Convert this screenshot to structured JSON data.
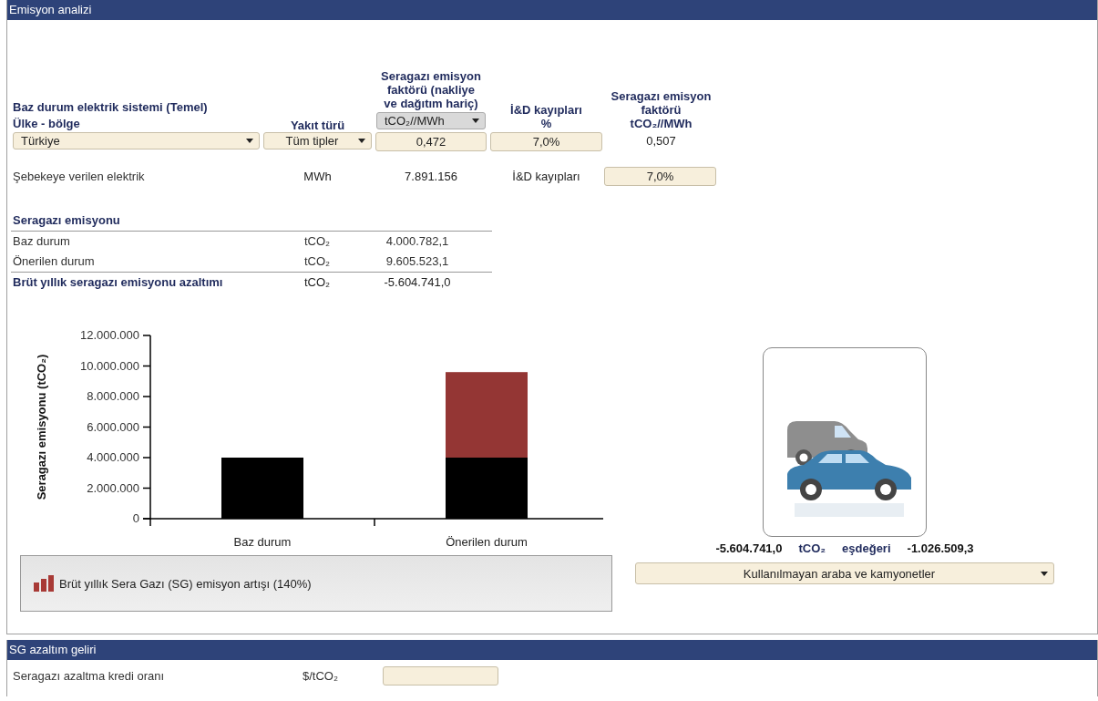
{
  "panel": {
    "title": "Emisyon analizi"
  },
  "baseline": {
    "heading": "Baz durum elektrik sistemi (Temel)",
    "columns": [
      {
        "label": "Ülke - bölge"
      },
      {
        "label": "Yakıt türü"
      },
      {
        "label": "Seragazı emisyon faktörü (nakliye ve dağıtım hariç)",
        "unit_selector": "tCO₂//MWh"
      },
      {
        "label": "İ&D kayıpları",
        "unit": "%"
      },
      {
        "label": "Seragazı emisyon faktörü",
        "unit": "tCO₂//MWh"
      }
    ],
    "row": [
      {
        "kind": "dropdown",
        "value": "Türkiye"
      },
      {
        "kind": "dropdown",
        "value": "Tüm tipler"
      },
      {
        "kind": "input",
        "value": "0,472"
      },
      {
        "kind": "input",
        "value": "7,0%"
      },
      {
        "kind": "text",
        "value": "0,507"
      }
    ]
  },
  "electricity": {
    "label": "Şebekeye verilen elektrik",
    "unit": "MWh",
    "value": "7.891.156",
    "losses_label": "İ&D kayıpları",
    "losses_value": "7,0%"
  },
  "emissions": {
    "heading": "Seragazı emisyonu",
    "rows": [
      {
        "kind": "normal",
        "label": "Baz durum",
        "unit": "tCO₂",
        "value": "4.000.782,1"
      },
      {
        "kind": "normal",
        "label": "Önerilen durum",
        "unit": "tCO₂",
        "value": "9.605.523,1"
      },
      {
        "kind": "total",
        "label": "Brüt yıllık seragazı emisyonu azaltımı",
        "unit": "tCO₂",
        "value": "-5.604.741,0"
      }
    ]
  },
  "chart": {
    "chart_data": {
      "type": "bar",
      "ylabel": "Seragazı emisyonu (tCO₂)",
      "categories": [
        "Baz durum",
        "Önerilen durum"
      ],
      "stacked": true,
      "ylim": [
        0,
        12000000
      ],
      "yticks": [
        0,
        {
          "value": 2000000,
          "label": "2.000.000"
        },
        {
          "value": 4000000,
          "label": "4.000.000"
        },
        {
          "value": 6000000,
          "label": "6.000.000"
        },
        {
          "value": 8000000,
          "label": "8.000.000"
        },
        {
          "value": 10000000,
          "label": "10.000.000"
        },
        {
          "value": 12000000,
          "label": "12.000.000"
        }
      ],
      "series": [
        {
          "color": "#000000",
          "values": [
            4000000,
            4000000
          ]
        },
        {
          "color": "#943634",
          "values": [
            0,
            5600000
          ]
        }
      ]
    }
  },
  "legend": {
    "text": "Brüt yıllık Sera Gazı (SG) emisyon artışı (140%)"
  },
  "equivalent": {
    "emission": "-5.604.741,0",
    "unit": "tCO₂",
    "label": "eşdeğeri",
    "value": "-1.026.509,3",
    "selector": "Kullanılmayan araba ve kamyonetler"
  },
  "revenue": {
    "title": "SG azaltım geliri",
    "rows": [
      {
        "label": "Seragazı azaltma kredi oranı",
        "unit": "$/tCO₂"
      }
    ]
  }
}
